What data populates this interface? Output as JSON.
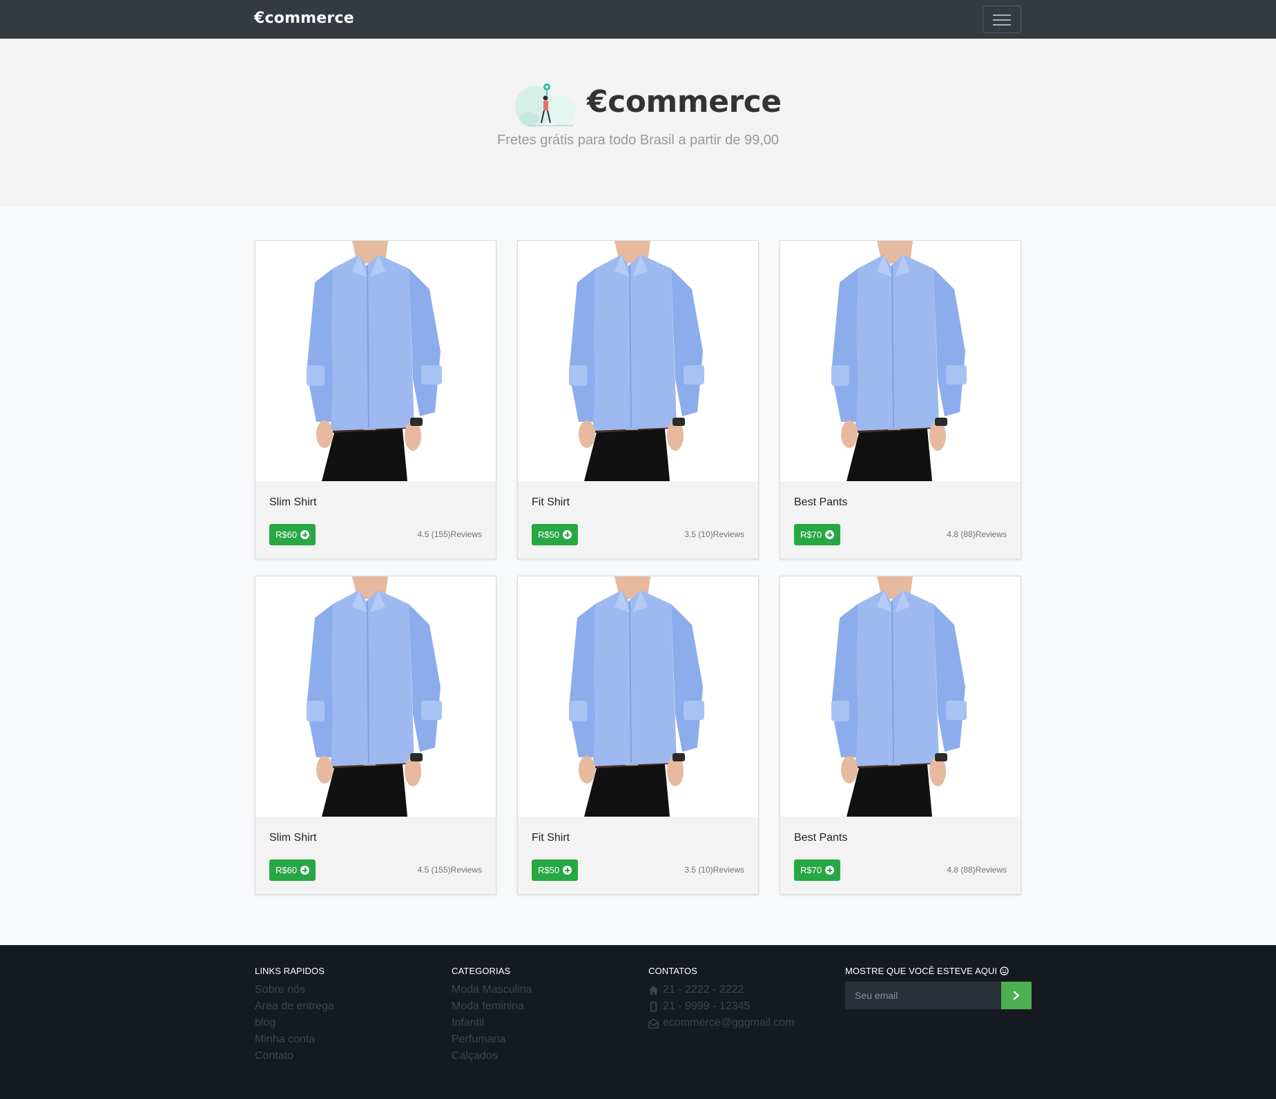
{
  "navbar": {
    "brand": "€commerce"
  },
  "hero": {
    "title": "€commerce",
    "subtitle": "Fretes grátis para todo Brasil a partir de 99,00"
  },
  "products": [
    {
      "name": "Slim Shirt",
      "price": "R$60",
      "reviews": "4.5 (155)Reviews"
    },
    {
      "name": "Fit Shirt",
      "price": "R$50",
      "reviews": "3.5 (10)Reviews"
    },
    {
      "name": "Best Pants",
      "price": "R$70",
      "reviews": "4.8 (88)Reviews"
    },
    {
      "name": "Slim Shirt",
      "price": "R$60",
      "reviews": "4.5 (155)Reviews"
    },
    {
      "name": "Fit Shirt",
      "price": "R$50",
      "reviews": "3.5 (10)Reviews"
    },
    {
      "name": "Best Pants",
      "price": "R$70",
      "reviews": "4.8 (88)Reviews"
    }
  ],
  "footer": {
    "quick_links": {
      "title": "LINKS RAPIDOS",
      "items": [
        "Sobre nós",
        "Area de entrega",
        "blog",
        "Minha conta",
        "Contato"
      ]
    },
    "categories": {
      "title": "CATEGORIAS",
      "items": [
        "Moda Masculina",
        "Moda feminina",
        "Infantil",
        "Perfumaria",
        "Calçados"
      ]
    },
    "contacts": {
      "title": "CONTATOS",
      "phone": "21 - 2222 - 2222",
      "mobile": "21 - 9999 - 12345",
      "email": "ecommerce@gggmail.com"
    },
    "newsletter": {
      "title": "MOSTRE QUE VOCÊ ESTEVE AQUI",
      "placeholder": "Seu email"
    }
  },
  "colors": {
    "navbar": "#343a40",
    "price_button": "#28a745",
    "footer": "#151a20",
    "submit": "#4caf50"
  }
}
